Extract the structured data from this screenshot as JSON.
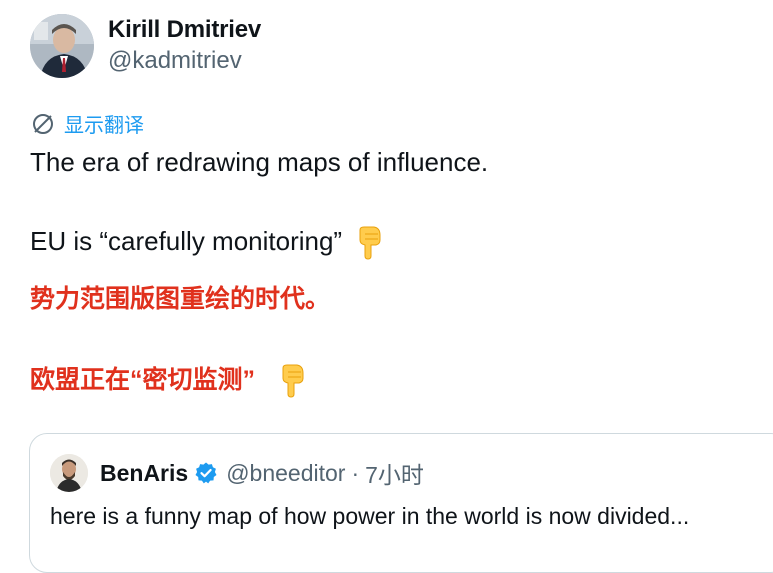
{
  "author": {
    "display_name": "Kirill Dmitriev",
    "handle": "@kadmitriev"
  },
  "translate": {
    "label": "显示翻译"
  },
  "tweet": {
    "line1": "The era of redrawing maps of influence.",
    "line2": "EU is “carefully monitoring”",
    "line3": "势力范围版图重绘的时代。",
    "line4": "欧盟正在“密切监测”"
  },
  "quoted": {
    "display_name": "BenAris",
    "handle": "@bneeditor",
    "separator": "·",
    "time": "7小时",
    "text": "here is a funny map of how power in the world is now divided..."
  },
  "colors": {
    "link": "#1d9bf0",
    "secondary_text": "#536471",
    "chinese_text": "#e0311d",
    "verified": "#1d9bf0"
  },
  "icons": [
    "translate-icon",
    "pointing-down-emoji",
    "verified-badge-icon"
  ]
}
